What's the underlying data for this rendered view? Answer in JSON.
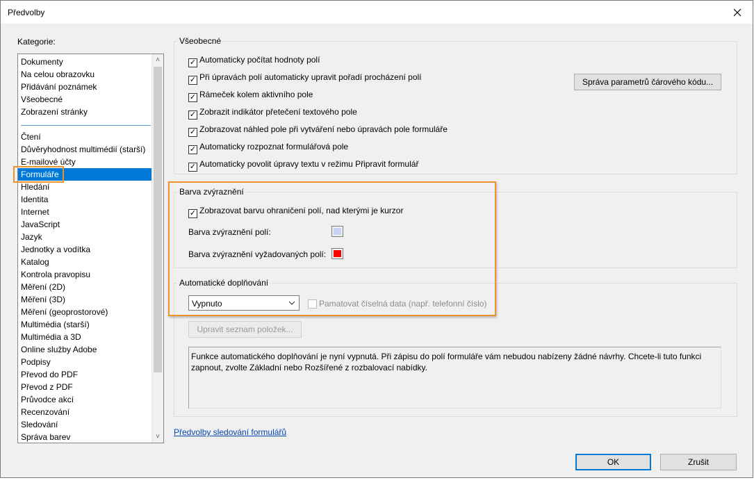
{
  "dialog": {
    "title": "Předvolby"
  },
  "categories": {
    "label": "Kategorie:",
    "group1": [
      "Dokumenty",
      "Na celou obrazovku",
      "Přidávání poznámek",
      "Všeobecné",
      "Zobrazení stránky"
    ],
    "group2": [
      "Čtení",
      "Důvěryhodnost multimédií (starší)",
      "E-mailové účty",
      "Formuláře",
      "Hledání",
      "Identita",
      "Internet",
      "JavaScript",
      "Jazyk",
      "Jednotky a vodítka",
      "Katalog",
      "Kontrola pravopisu",
      "Měření (2D)",
      "Měření (3D)",
      "Měření (geoprostorové)",
      "Multimédia (starší)",
      "Multimédia a 3D",
      "Online služby Adobe",
      "Podpisy",
      "Převod do PDF",
      "Převod z PDF",
      "Průvodce akcí",
      "Recenzování",
      "Sledování",
      "Správa barev"
    ],
    "selected": "Formuláře"
  },
  "general": {
    "title": "Všeobecné",
    "checkboxes": [
      {
        "label": "Automaticky počítat hodnoty polí",
        "checked": true
      },
      {
        "label": "Při úpravách polí automaticky upravit pořadí procházení polí",
        "checked": true
      },
      {
        "label": "Rámeček kolem aktivního pole",
        "checked": true
      },
      {
        "label": "Zobrazit indikátor přetečení textového pole",
        "checked": true
      },
      {
        "label": "Zobrazovat náhled pole při vytváření nebo úpravách pole formuláře",
        "checked": true
      },
      {
        "label": "Automaticky rozpoznat formulářová pole",
        "checked": true
      },
      {
        "label": "Automaticky povolit úpravy textu v režimu Připravit formulář",
        "checked": true
      }
    ],
    "barcode_button": "Správa parametrů čárového kódu..."
  },
  "highlight": {
    "title": "Barva zvýraznění",
    "show_border_label": "Zobrazovat barvu ohraničení polí, nad kterými je kurzor",
    "show_border_checked": true,
    "field_color_label": "Barva zvýraznění polí:",
    "field_color": "#c8d2f5",
    "required_color_label": "Barva zvýraznění vyžadovaných polí:",
    "required_color": "#ff0000"
  },
  "autocomplete": {
    "title": "Automatické doplňování",
    "select_value": "Vypnuto",
    "remember_label": "Pamatovat číselná data (např. telefonní číslo)",
    "remember_checked": false,
    "edit_list_button": "Upravit seznam položek...",
    "info_text": "Funkce automatického doplňování je nyní vypnutá. Při zápisu do polí formuláře vám nebudou nabízeny žádné návrhy. Chcete-li tuto funkci zapnout, zvolte Základní nebo Rozšířené z rozbalovací nabídky."
  },
  "footer": {
    "tracking_link": "Předvolby sledování formulářů",
    "ok": "OK",
    "cancel": "Zrušit"
  },
  "colors": {
    "selection": "#0078d7",
    "annotation_highlight": "#f0922a"
  }
}
